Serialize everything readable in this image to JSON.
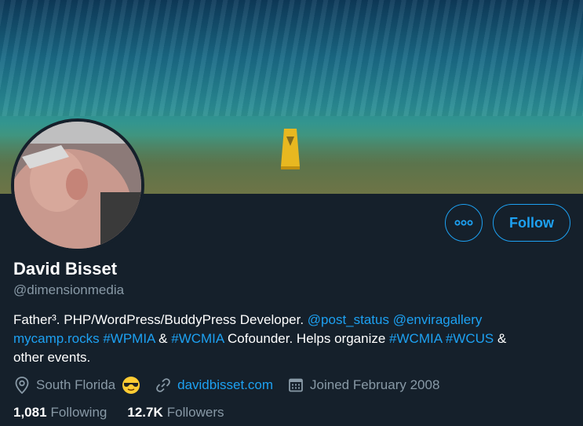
{
  "profile": {
    "name": "David Bisset",
    "handle": "@dimensionmedia",
    "bio": {
      "p1": "Father³. PHP/WordPress/BuddyPress Developer. ",
      "mention1": "@post_status",
      "sp1": " ",
      "mention2": "@enviragallery",
      "link1": "mycamp.rocks",
      "sp2": " ",
      "tag1": "#WPMIA",
      "amp": " & ",
      "tag2": "#WCMIA",
      "p2": " Cofounder. Helps organize ",
      "tag3": "#WCMIA",
      "sp3": " ",
      "tag4": "#WCUS",
      "p3": " &",
      "p4": "other events."
    },
    "location": "South Florida",
    "website": "davidbisset.com",
    "joined": "Joined February 2008",
    "following_count": "1,081",
    "following_label": "Following",
    "followers_count": "12.7K",
    "followers_label": "Followers"
  },
  "actions": {
    "follow_label": "Follow",
    "more_icon": "more-dots-icon"
  },
  "colors": {
    "accent": "#1da1f2",
    "background": "#15202b",
    "muted": "#8899a6"
  }
}
